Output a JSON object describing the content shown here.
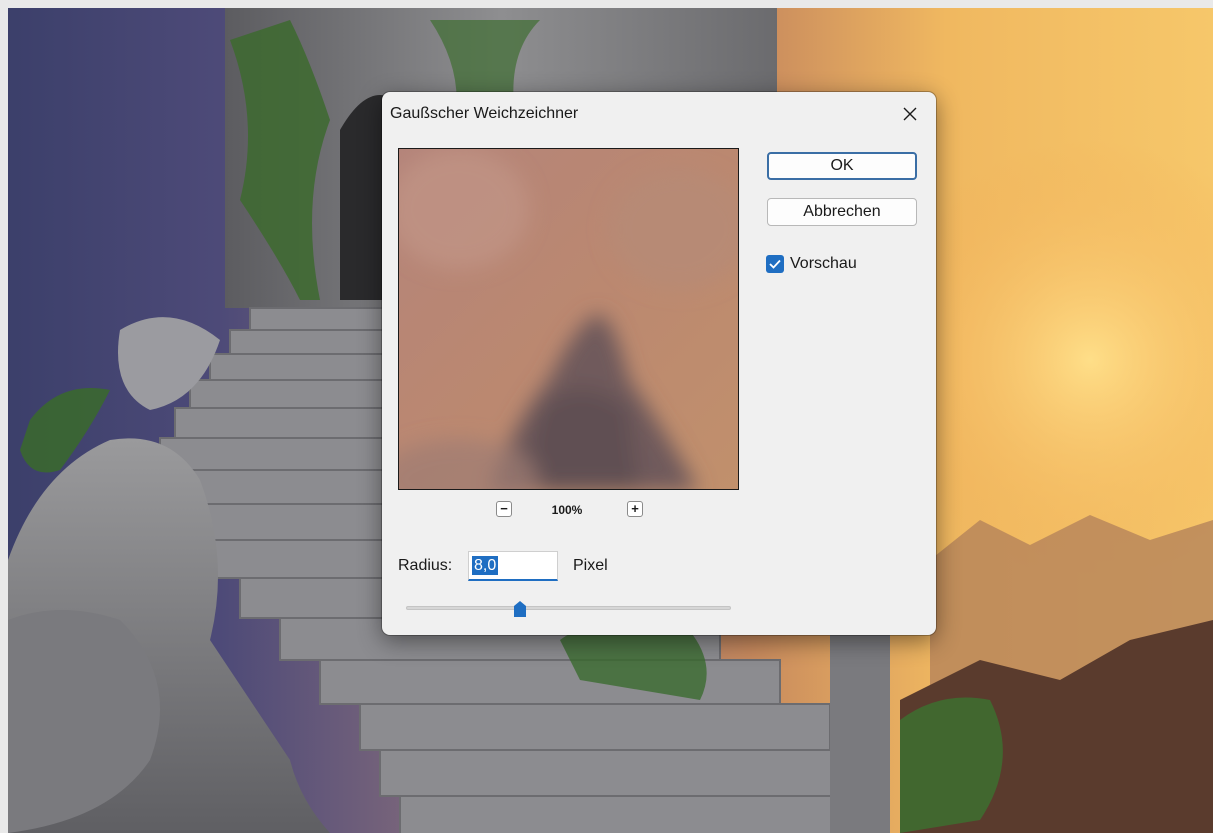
{
  "dialog": {
    "title": "Gaußscher Weichzeichner",
    "close_icon": "close-icon",
    "preview": {
      "zoom_level": "100%",
      "zoom_out_label": "−",
      "zoom_in_label": "+"
    },
    "buttons": {
      "ok": "OK",
      "cancel": "Abbrechen"
    },
    "preview_checkbox": {
      "label": "Vorschau",
      "checked": true
    },
    "radius": {
      "label": "Radius:",
      "value": "8,0",
      "unit": "Pixel",
      "slider_fraction": 0.35
    }
  },
  "colors": {
    "accent": "#1f6ec2",
    "dialog_bg": "#f0f0f0"
  }
}
